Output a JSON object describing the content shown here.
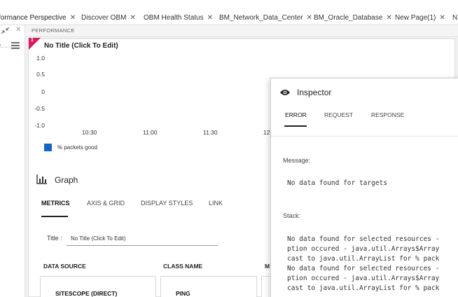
{
  "tabs": [
    {
      "label": "formance Perspective",
      "close": "✕"
    },
    {
      "label": "Discover OBM",
      "close": "✕"
    },
    {
      "label": "OBM Health Status",
      "close": "✕"
    },
    {
      "label": "BM_Network_Data_Center",
      "close": "✕"
    },
    {
      "label": "BM_Oracle_Database",
      "close": "✕"
    },
    {
      "label": "New Page(1)",
      "close": "✕"
    },
    {
      "label": "N",
      "close": ""
    }
  ],
  "strip": {
    "label": "PERFORMANCE"
  },
  "chart": {
    "title": "No Title (Click To Edit)",
    "badge": "1",
    "legend": "% packets good",
    "legend_color": "#1565c0"
  },
  "chart_data": {
    "type": "line",
    "title": "No Title (Click To Edit)",
    "x_ticks": [
      "10:30",
      "11:00",
      "11:30",
      "12"
    ],
    "y_ticks": [
      "1.0",
      "0.5",
      "0",
      "-0.5",
      "-1.0"
    ],
    "ylim": [
      -1.0,
      1.0
    ],
    "series": [
      {
        "name": "% packets good",
        "values": []
      }
    ],
    "legend_position": "bottom-left",
    "grid": false
  },
  "graph": {
    "title": "Graph",
    "tabs": [
      "METRICS",
      "AXIS & GRID",
      "DISPLAY STYLES",
      "LINK"
    ],
    "title_label": "Title :",
    "title_value": "No Title (Click To Edit)",
    "columns": [
      "DATA SOURCE",
      "CLASS NAME",
      "M"
    ],
    "row": [
      "SITESCOPE (DIRECT)",
      "PING"
    ]
  },
  "inspector": {
    "title": "Inspector",
    "tabs": [
      "ERROR",
      "REQUEST",
      "RESPONSE"
    ],
    "message_label": "Message:",
    "message": "No data found for targets",
    "stack_label": "Stack:",
    "stack_lines": [
      "No data found for selected resources -",
      "ption occured - java.util.Arrays$Array",
      "cast to java.util.ArrayList for % pack",
      "No data found for selected resources -",
      "ption occured - java.util.Arrays$Array",
      "cast to java.util.ArrayList for % pack"
    ]
  }
}
